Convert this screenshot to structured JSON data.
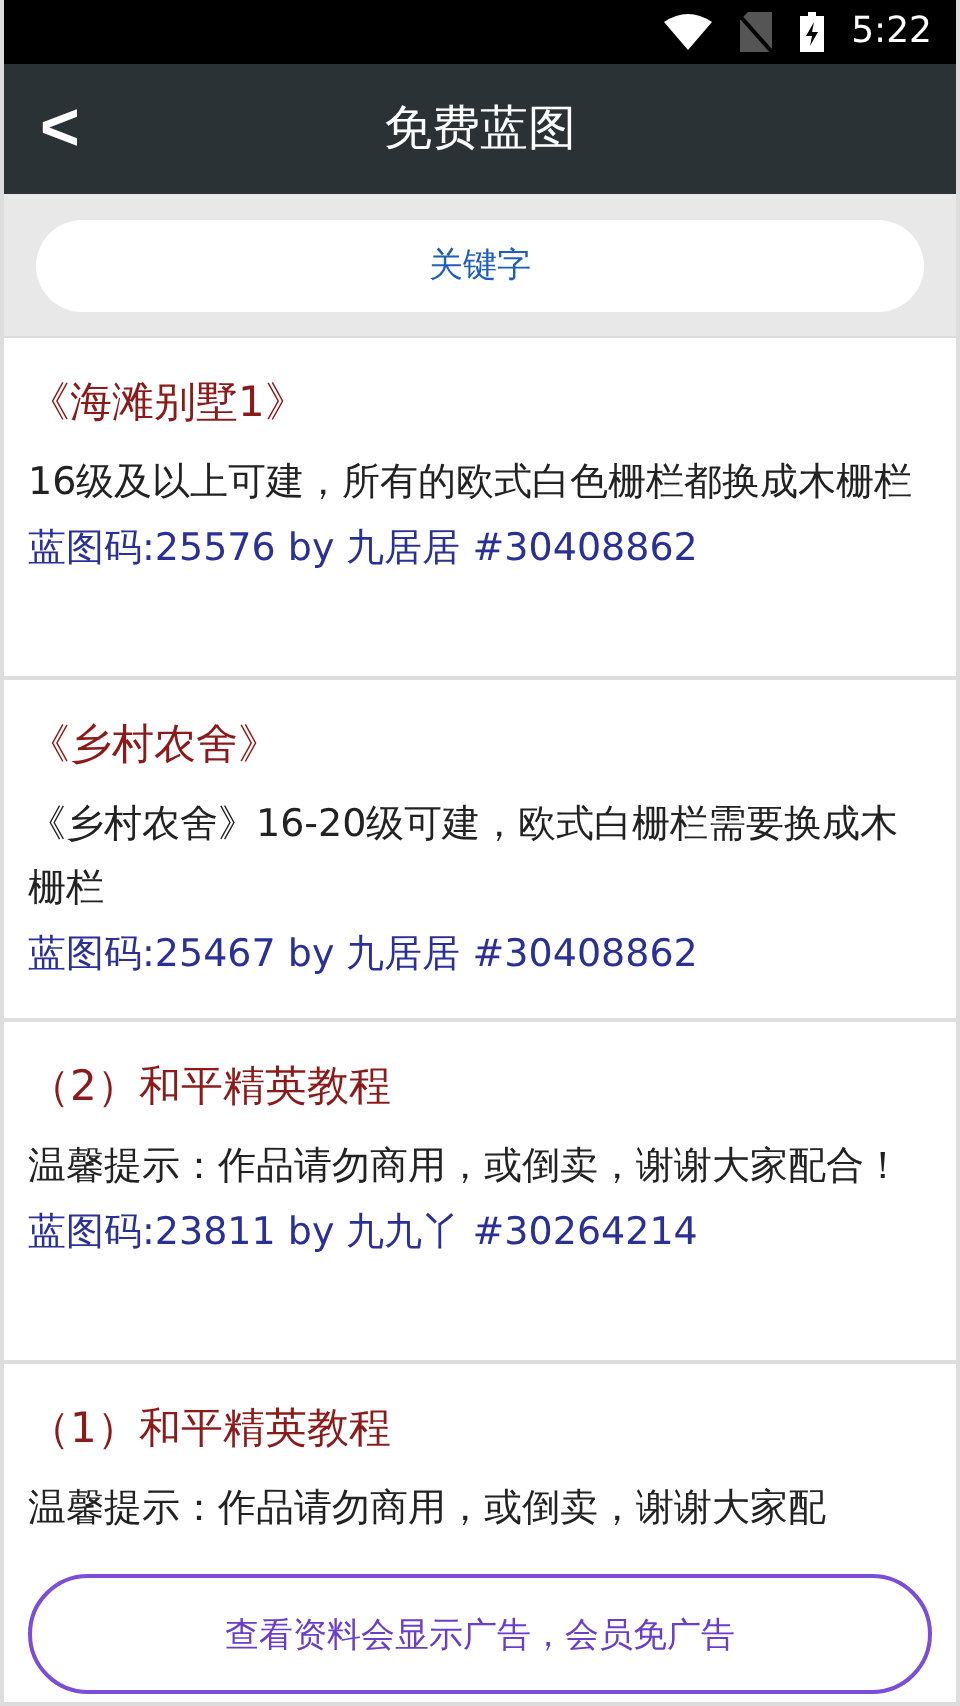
{
  "status_bar": {
    "time": "5:22"
  },
  "header": {
    "back": "<",
    "title": "免费蓝图"
  },
  "search": {
    "placeholder": "关键字"
  },
  "items": [
    {
      "title": "《海滩别墅1》",
      "description": "16级及以上可建，所有的欧式白色栅栏都换成木栅栏",
      "code": "蓝图码:25576 by 九居居 #30408862"
    },
    {
      "title": "《乡村农舍》",
      "description": "《乡村农舍》16-20级可建，欧式白栅栏需要换成木栅栏",
      "code": "蓝图码:25467 by 九居居 #30408862"
    },
    {
      "title": "（2）和平精英教程",
      "description": "温馨提示：作品请勿商用，或倒卖，谢谢大家配合！",
      "code": "蓝图码:23811 by 九九丫 #30264214"
    },
    {
      "title": "（1）和平精英教程",
      "description": "温馨提示：作品请勿商用，或倒卖，谢谢大家配"
    }
  ],
  "ad_button": "查看资料会显示广告，会员免广告"
}
